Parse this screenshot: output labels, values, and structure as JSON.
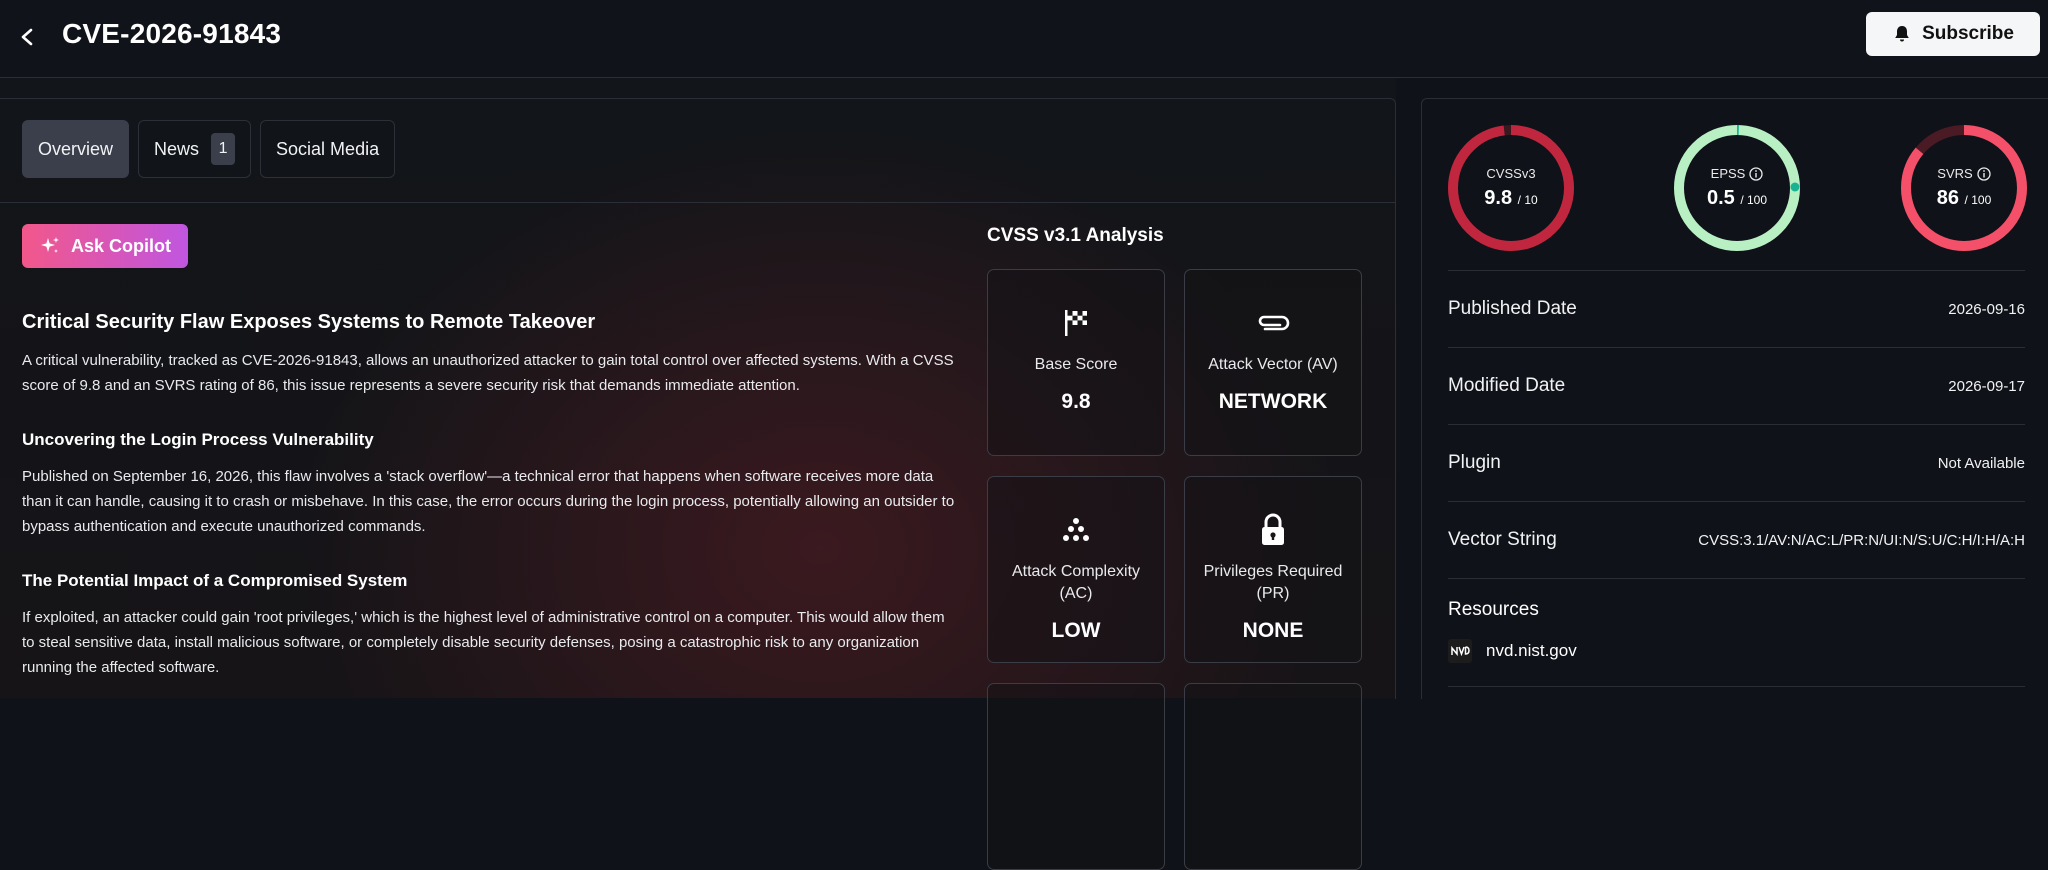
{
  "header": {
    "title": "CVE-2026-91843",
    "subscribe_label": "Subscribe"
  },
  "tabs": [
    {
      "label": "Overview",
      "active": true
    },
    {
      "label": "News",
      "count": "1"
    },
    {
      "label": "Social Media"
    }
  ],
  "copilot_label": "Ask Copilot",
  "article": {
    "title": "Critical Security Flaw Exposes Systems to Remote Takeover",
    "intro": "A critical vulnerability, tracked as CVE-2026-91843, allows an unauthorized attacker to gain total control over affected systems. With a CVSS score of 9.8 and an SVRS rating of 86, this issue represents a severe security risk that demands immediate attention.",
    "section1_title": "Uncovering the Login Process Vulnerability",
    "section1_text": "Published on September 16, 2026, this flaw involves a 'stack overflow'—a technical error that happens when software receives more data than it can handle, causing it to crash or misbehave. In this case, the error occurs during the login process, potentially allowing an outsider to bypass authentication and execute unauthorized commands.",
    "section2_title": "The Potential Impact of a Compromised System",
    "section2_text": "If exploited, an attacker could gain 'root privileges,' which is the highest level of administrative control on a computer. This would allow them to steal sensitive data, install malicious software, or completely disable security defenses, posing a catastrophic risk to any organization running the affected software."
  },
  "analysis": {
    "title": "CVSS v3.1 Analysis",
    "metrics": [
      {
        "label": "Base Score",
        "value": "9.8",
        "icon": "checkered-flag-icon"
      },
      {
        "label": "Attack Vector (AV)",
        "value": "NETWORK",
        "icon": "paperclip-icon"
      },
      {
        "label": "Attack Complexity (AC)",
        "value": "LOW",
        "icon": "dots-pyramid-icon"
      },
      {
        "label": "Privileges Required (PR)",
        "value": "NONE",
        "icon": "lock-icon"
      }
    ]
  },
  "scores": {
    "cvss": {
      "label": "CVSSv3",
      "value": "9.8",
      "max": "/ 10",
      "fraction": 0.98,
      "color": "#c0273f"
    },
    "epss": {
      "label": "EPSS",
      "value": "0.5",
      "max": "/ 100",
      "fraction": 0.005,
      "color": "#19b394",
      "track": "#b8f0c4"
    },
    "svrs": {
      "label": "SVRS",
      "value": "86",
      "max": "/ 100",
      "fraction": 0.86,
      "color": "#f4506a"
    }
  },
  "details": [
    {
      "label": "Published Date",
      "value": "2026-09-16"
    },
    {
      "label": "Modified Date",
      "value": "2026-09-17"
    },
    {
      "label": "Plugin",
      "value": "Not Available"
    },
    {
      "label": "Vector String",
      "value": "CVSS:3.1/AV:N/AC:L/PR:N/UI:N/S:U/C:H/I:H/A:H"
    }
  ],
  "resources": {
    "title": "Resources",
    "items": [
      {
        "label": "nvd.nist.gov",
        "icon": "nvd-logo-icon"
      }
    ]
  }
}
